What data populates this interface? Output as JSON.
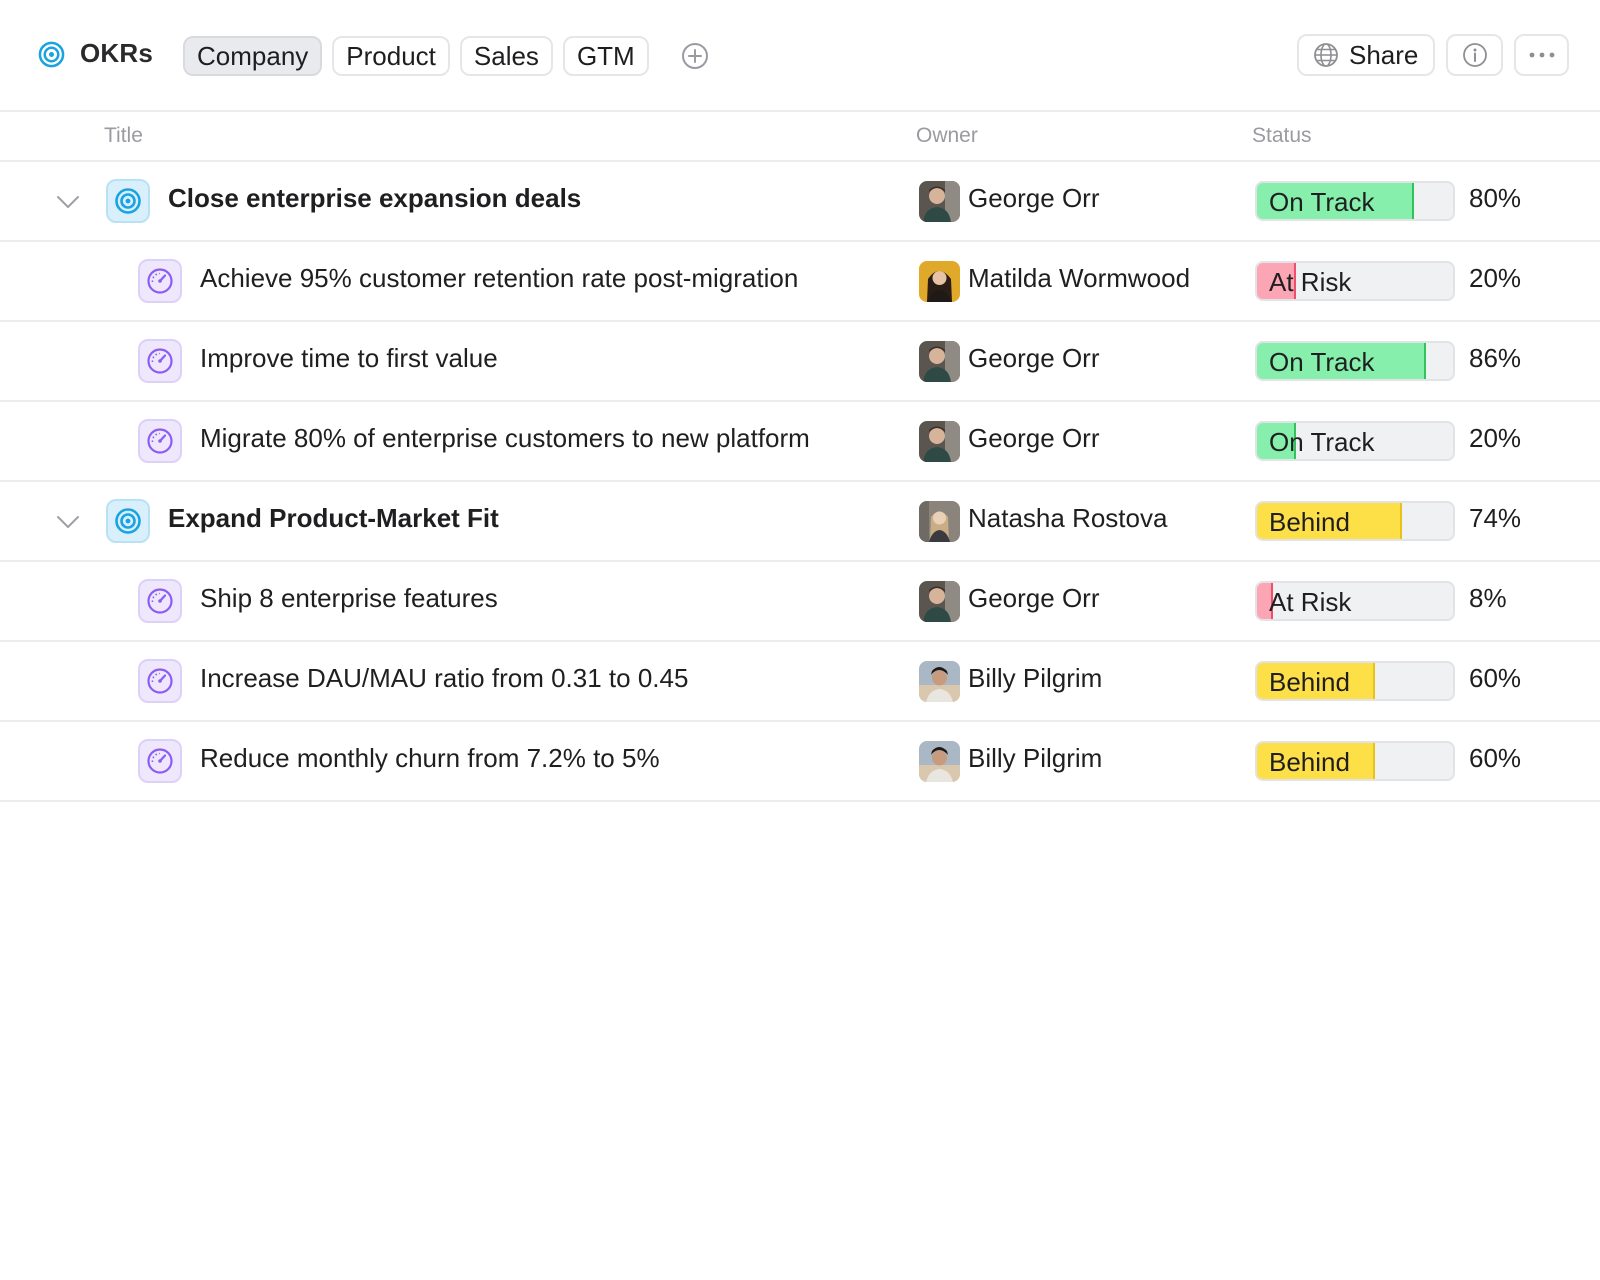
{
  "header": {
    "title": "OKRs",
    "tabs": [
      "Company",
      "Product",
      "Sales",
      "GTM"
    ],
    "active_tab": "Company",
    "share_label": "Share",
    "icons": {
      "app": "target-icon",
      "add_tab": "plus-circle-icon",
      "share": "globe-icon",
      "info": "info-icon",
      "more": "more-horizontal-icon"
    }
  },
  "columns": {
    "title": "Title",
    "owner": "Owner",
    "status": "Status"
  },
  "status_colors": {
    "On Track": {
      "fill": "#86efac",
      "edge": "#34c05a"
    },
    "At Risk": {
      "fill": "#fca5b4",
      "edge": "#ef4f6b"
    },
    "Behind": {
      "fill": "#fde047",
      "edge": "#e8c21a"
    }
  },
  "rows": [
    {
      "type": "objective",
      "title": "Close enterprise expansion deals",
      "owner": "George Orr",
      "status": "On Track",
      "progress": 80,
      "progress_label": "80%"
    },
    {
      "type": "key_result",
      "title": "Achieve 95% customer retention rate post-migration",
      "owner": "Matilda Wormwood",
      "status": "At Risk",
      "progress": 20,
      "progress_label": "20%"
    },
    {
      "type": "key_result",
      "title": "Improve time to first value",
      "owner": "George Orr",
      "status": "On Track",
      "progress": 86,
      "progress_label": "86%"
    },
    {
      "type": "key_result",
      "title": "Migrate 80% of enterprise customers to new platform",
      "owner": "George Orr",
      "status": "On Track",
      "progress": 20,
      "progress_label": "20%"
    },
    {
      "type": "objective",
      "title": "Expand Product-Market Fit",
      "owner": "Natasha Rostova",
      "status": "Behind",
      "progress": 74,
      "progress_label": "74%"
    },
    {
      "type": "key_result",
      "title": "Ship 8 enterprise features",
      "owner": "George Orr",
      "status": "At Risk",
      "progress": 8,
      "progress_label": "8%"
    },
    {
      "type": "key_result",
      "title": "Increase DAU/MAU ratio from 0.31 to 0.45",
      "owner": "Billy Pilgrim",
      "status": "Behind",
      "progress": 60,
      "progress_label": "60%"
    },
    {
      "type": "key_result",
      "title": "Reduce monthly churn from 7.2% to 5%",
      "owner": "Billy Pilgrim",
      "status": "Behind",
      "progress": 60,
      "progress_label": "60%"
    }
  ]
}
